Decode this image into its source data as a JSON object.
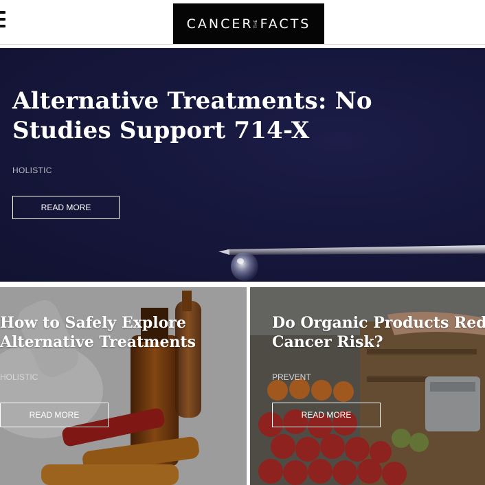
{
  "header": {
    "logo_left": "CANCER",
    "logo_the": "THE",
    "logo_right": "FACTS"
  },
  "hero": {
    "title": "Alternative Treatments: No Studies Support 714-X",
    "category": "HOLISTIC",
    "read_more": "READ MORE"
  },
  "cards": [
    {
      "title_line1": "How to Safely Explore",
      "title_line2": "Alternative Treatments",
      "category": "HOLISTIC",
      "read_more": "READ MORE"
    },
    {
      "title_line1": "Do Organic Products Reduce",
      "title_line2": "Cancer Risk?",
      "category": "PREVENT",
      "read_more": "READ MORE"
    }
  ],
  "icons": {
    "menu": "hamburger-menu-icon"
  },
  "colors": {
    "hero_background": "#16173c",
    "logo_background": "#050505",
    "text_on_dark": "#ffffff"
  }
}
